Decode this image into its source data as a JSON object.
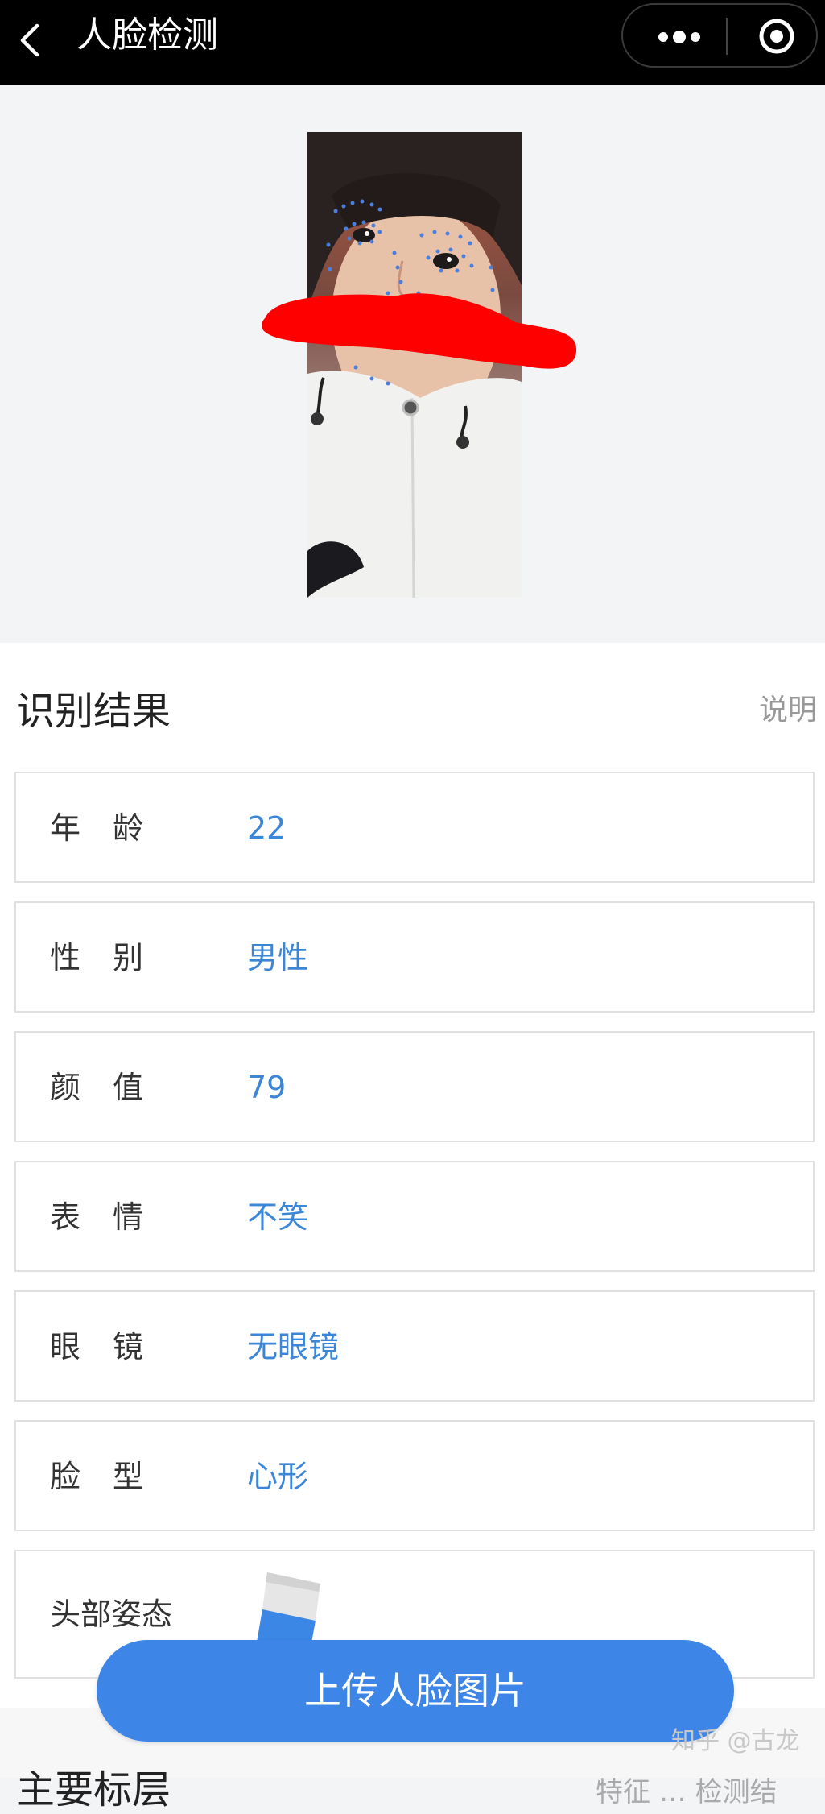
{
  "navbar": {
    "title": "人脸检测",
    "back_icon": "back-arrow-icon",
    "more_icon": "more-dots-icon",
    "close_icon": "close-miniprogram-icon"
  },
  "photo": {
    "icon": "face-photo-with-landmarks",
    "landmark_color": "#4a7fe0",
    "redaction_color": "#ff0000"
  },
  "result": {
    "title": "识别结果",
    "help_label": "说明",
    "rows": [
      {
        "label_chars": [
          "年",
          "龄"
        ],
        "value": "22"
      },
      {
        "label_chars": [
          "性",
          "别"
        ],
        "value": "男性"
      },
      {
        "label_chars": [
          "颜",
          "值"
        ],
        "value": "79"
      },
      {
        "label_chars": [
          "表",
          "情"
        ],
        "value": "不笑"
      },
      {
        "label_chars": [
          "眼",
          "镜"
        ],
        "value": "无眼镜"
      },
      {
        "label_chars": [
          "脸",
          "型"
        ],
        "value": "心形"
      }
    ],
    "pose": {
      "label": "头部姿态",
      "icon": "head-pose-cube-icon"
    }
  },
  "next_section": {
    "title": "主要标层",
    "right": "特征 … 检测结"
  },
  "upload_button": {
    "label": "上传人脸图片"
  },
  "watermark": "知乎 @古龙",
  "colors": {
    "navbar": "#000000",
    "value_text": "#3b86d6",
    "button": "#3d86e8",
    "background": "#f3f4f6"
  }
}
